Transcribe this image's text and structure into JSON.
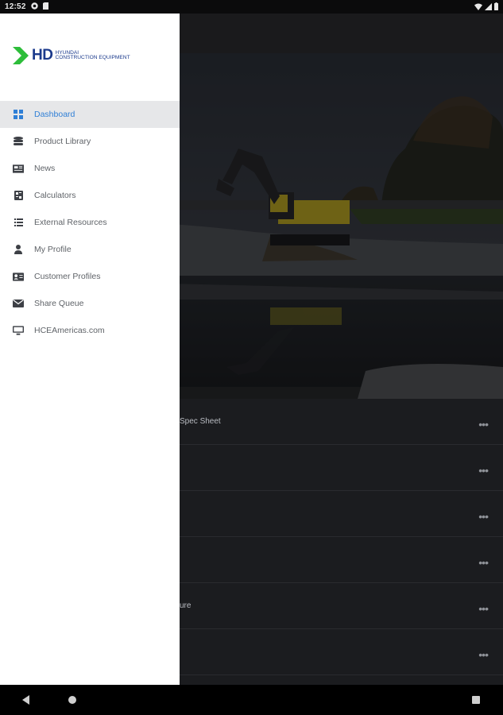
{
  "status_bar": {
    "time": "12:52"
  },
  "drawer": {
    "logo": {
      "hd": "HD",
      "line1": "HYUNDAI",
      "line2": "CONSTRUCTION EQUIPMENT",
      "brand_color": "#1b3a8c",
      "accent": "#2dbd3a"
    },
    "items": [
      {
        "label": "Dashboard",
        "icon": "dashboard-icon",
        "active": true
      },
      {
        "label": "Product Library",
        "icon": "stack-icon"
      },
      {
        "label": "News",
        "icon": "newspaper-icon"
      },
      {
        "label": "Calculators",
        "icon": "calculator-icon"
      },
      {
        "label": "External Resources",
        "icon": "list-icon"
      },
      {
        "label": "My Profile",
        "icon": "person-icon"
      },
      {
        "label": "Customer Profiles",
        "icon": "id-card-icon"
      },
      {
        "label": "Share Queue",
        "icon": "envelope-icon"
      },
      {
        "label": "HCEAmericas.com",
        "icon": "monitor-icon"
      }
    ],
    "active_color": "#2f7fd6"
  },
  "main": {
    "carousel": {
      "total": 6,
      "active_index": 2
    },
    "rows": [
      {
        "text": "Spec Sheet"
      },
      {
        "text": ""
      },
      {
        "text": ""
      },
      {
        "text": ""
      },
      {
        "text": "ure"
      },
      {
        "text": ""
      }
    ],
    "more_label": "•••"
  }
}
